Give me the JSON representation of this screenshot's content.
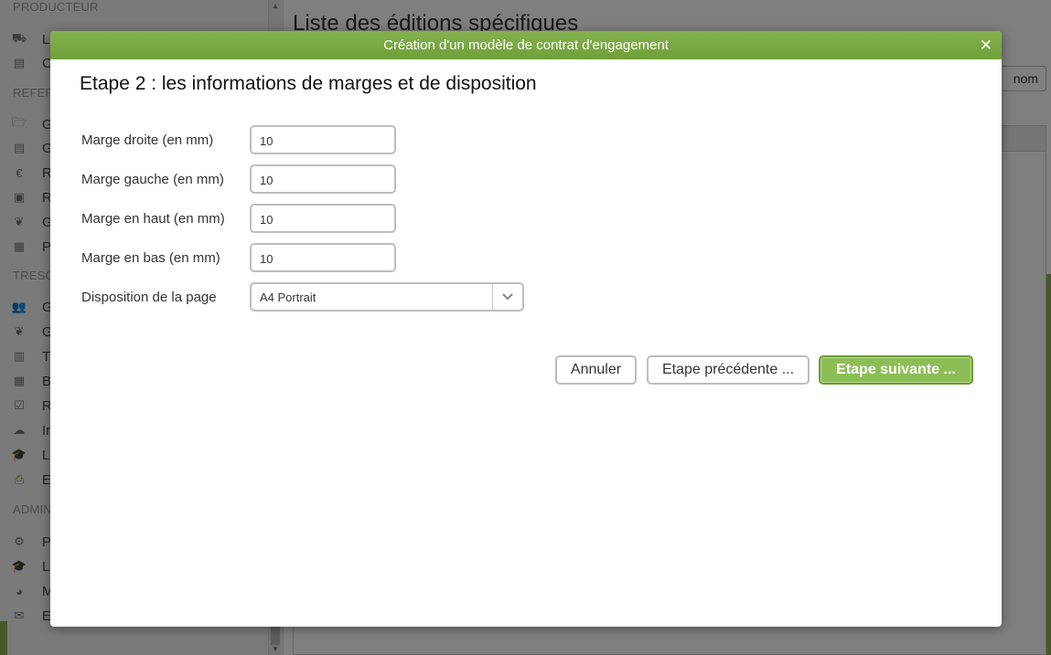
{
  "background": {
    "sidebar": {
      "sections": [
        "PRODUCTEUR",
        "REFER",
        "TRESO",
        "ADMIN"
      ],
      "items": [
        {
          "icon": "truck-icon",
          "glyph": "⛟",
          "label": "L"
        },
        {
          "icon": "document-icon",
          "glyph": "▤",
          "label": "C"
        },
        {
          "icon": "folder-icon",
          "glyph": "🗁",
          "label": "G"
        },
        {
          "icon": "file-icon",
          "glyph": "▤",
          "label": "G"
        },
        {
          "icon": "euro-icon",
          "glyph": "€",
          "label": "R"
        },
        {
          "icon": "money-icon",
          "glyph": "▣",
          "label": "R"
        },
        {
          "icon": "leaf-icon",
          "glyph": "❦",
          "label": "G"
        },
        {
          "icon": "calendar-icon",
          "glyph": "▦",
          "label": "P"
        },
        {
          "icon": "users-icon",
          "glyph": "👥",
          "label": "G"
        },
        {
          "icon": "leaf-icon",
          "glyph": "❦",
          "label": "G"
        },
        {
          "icon": "bar-chart-icon",
          "glyph": "▥",
          "label": "T"
        },
        {
          "icon": "table-icon",
          "glyph": "▦",
          "label": "B"
        },
        {
          "icon": "checkbox-icon",
          "glyph": "☑",
          "label": "R"
        },
        {
          "icon": "cloud-icon",
          "glyph": "☁",
          "label": "Ir"
        },
        {
          "icon": "graduation-icon",
          "glyph": "🎓",
          "label": "L"
        },
        {
          "icon": "print-icon",
          "glyph": "⎙",
          "label": "E"
        },
        {
          "icon": "gear-icon",
          "glyph": "⚙",
          "label": "P"
        },
        {
          "icon": "graduation-icon",
          "glyph": "🎓",
          "label": "L"
        },
        {
          "icon": "dashboard-icon",
          "glyph": "◕",
          "label": "M"
        },
        {
          "icon": "envelope-icon",
          "glyph": "✉",
          "label": "E"
        }
      ]
    },
    "main": {
      "title": "Liste des éditions spécifiques",
      "button_label": "nom"
    }
  },
  "modal": {
    "title": "Création d'un modèle de contrat d'engagement",
    "close_glyph": "✕",
    "step_title": "Etape 2 : les informations de marges et de disposition",
    "fields": [
      {
        "label": "Marge droite (en mm)",
        "value": "10"
      },
      {
        "label": "Marge gauche (en mm)",
        "value": "10"
      },
      {
        "label": "Marge en haut (en mm)",
        "value": "10"
      },
      {
        "label": "Marge en bas (en mm)",
        "value": "10"
      }
    ],
    "layout_field": {
      "label": "Disposition de la page",
      "selected": "A4 Portrait"
    },
    "buttons": {
      "cancel": "Annuler",
      "previous": "Etape précédente ...",
      "next": "Etape suivante ..."
    }
  },
  "colors": {
    "header_green": "#78a843",
    "primary_button_green": "#8cbe55",
    "overlay": "rgba(0,0,0,0.5)"
  }
}
